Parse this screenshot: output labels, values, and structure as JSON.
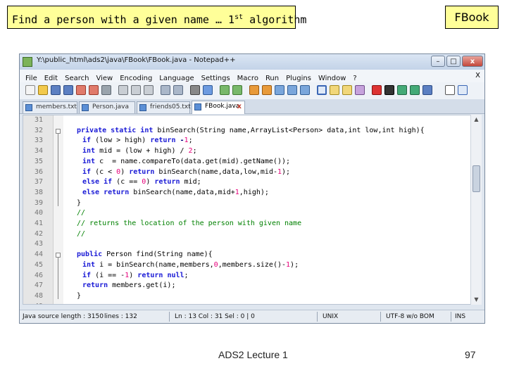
{
  "slide": {
    "title_main": "Find a person with a given name … 1",
    "title_sup": "st",
    "title_tail": " algorithm",
    "tag": "FBook",
    "footer": "ADS2 Lecture 1",
    "page_number": "97"
  },
  "window": {
    "title": "Y:\\public_html\\ads2\\java\\FBook\\FBook.java - Notepad++",
    "buttons": {
      "minimize": "–",
      "maximize": "□",
      "close": "x"
    },
    "menu": [
      "File",
      "Edit",
      "Search",
      "View",
      "Encoding",
      "Language",
      "Settings",
      "Macro",
      "Run",
      "Plugins",
      "Window",
      "?"
    ],
    "menu_close": "X",
    "tabs": [
      {
        "label": "members.txt",
        "active": false
      },
      {
        "label": "Person.java",
        "active": false
      },
      {
        "label": "friends05.txt",
        "active": false
      },
      {
        "label": "FBook.java",
        "active": true,
        "close": "x"
      }
    ],
    "lines": [
      {
        "n": "31",
        "tokens": []
      },
      {
        "n": "32",
        "tokens": [
          [
            "kw",
            "private static int "
          ],
          [
            "plain",
            "binSearch(String name,ArrayList<Person> data,int low,int high){"
          ]
        ]
      },
      {
        "n": "33",
        "tokens": [
          [
            "kw",
            "if "
          ],
          [
            "plain",
            "(low > high) "
          ],
          [
            "kw",
            "return "
          ],
          [
            "op",
            "-"
          ],
          [
            "num-lit",
            "1"
          ],
          [
            "plain",
            ";"
          ]
        ]
      },
      {
        "n": "34",
        "tokens": [
          [
            "kw",
            "int "
          ],
          [
            "plain",
            "mid = (low + high) / "
          ],
          [
            "num-lit",
            "2"
          ],
          [
            "plain",
            ";"
          ]
        ]
      },
      {
        "n": "35",
        "tokens": [
          [
            "kw",
            "int "
          ],
          [
            "plain",
            "c  = name.compareTo(data.get(mid).getName());"
          ]
        ]
      },
      {
        "n": "36",
        "tokens": [
          [
            "kw",
            "if "
          ],
          [
            "plain",
            "(c < "
          ],
          [
            "num-lit",
            "0"
          ],
          [
            "plain",
            ") "
          ],
          [
            "kw",
            "return "
          ],
          [
            "plain",
            "binSearch(name,data,low,mid-"
          ],
          [
            "num-lit",
            "1"
          ],
          [
            "plain",
            ");"
          ]
        ]
      },
      {
        "n": "37",
        "tokens": [
          [
            "kw",
            "else if "
          ],
          [
            "plain",
            "(c == "
          ],
          [
            "num-lit",
            "0"
          ],
          [
            "plain",
            ") "
          ],
          [
            "kw",
            "return "
          ],
          [
            "plain",
            "mid;"
          ]
        ]
      },
      {
        "n": "38",
        "tokens": [
          [
            "kw",
            "else return "
          ],
          [
            "plain",
            "binSearch(name,data,mid+"
          ],
          [
            "num-lit",
            "1"
          ],
          [
            "plain",
            ",high);"
          ]
        ]
      },
      {
        "n": "39",
        "tokens": [
          [
            "plain",
            "}"
          ]
        ]
      },
      {
        "n": "40",
        "tokens": [
          [
            "cm",
            "//"
          ]
        ]
      },
      {
        "n": "41",
        "tokens": [
          [
            "cm",
            "// returns the location of the person with given name"
          ]
        ]
      },
      {
        "n": "42",
        "tokens": [
          [
            "cm",
            "//"
          ]
        ]
      },
      {
        "n": "43",
        "tokens": []
      },
      {
        "n": "44",
        "tokens": [
          [
            "kw",
            "public "
          ],
          [
            "plain",
            "Person find(String name){"
          ]
        ]
      },
      {
        "n": "45",
        "tokens": [
          [
            "kw",
            "int "
          ],
          [
            "plain",
            "i = binSearch(name,members,"
          ],
          [
            "num-lit",
            "0"
          ],
          [
            "plain",
            ",members.size()-"
          ],
          [
            "num-lit",
            "1"
          ],
          [
            "plain",
            ");"
          ]
        ]
      },
      {
        "n": "46",
        "tokens": [
          [
            "kw",
            "if "
          ],
          [
            "plain",
            "(i == -"
          ],
          [
            "num-lit",
            "1"
          ],
          [
            "plain",
            ") "
          ],
          [
            "kw",
            "return null"
          ],
          [
            "plain",
            ";"
          ]
        ]
      },
      {
        "n": "47",
        "tokens": [
          [
            "kw",
            "return "
          ],
          [
            "plain",
            "members.get(i);"
          ]
        ]
      },
      {
        "n": "48",
        "tokens": [
          [
            "plain",
            "}"
          ]
        ]
      },
      {
        "n": "49",
        "tokens": []
      }
    ],
    "status": {
      "source_length": "Java source length : 3150",
      "lines": "lines : 132",
      "position": "Ln : 13    Col : 31    Sel : 0 | 0",
      "eol": "UNIX",
      "encoding": "UTF-8 w/o BOM",
      "mode": "INS"
    }
  }
}
